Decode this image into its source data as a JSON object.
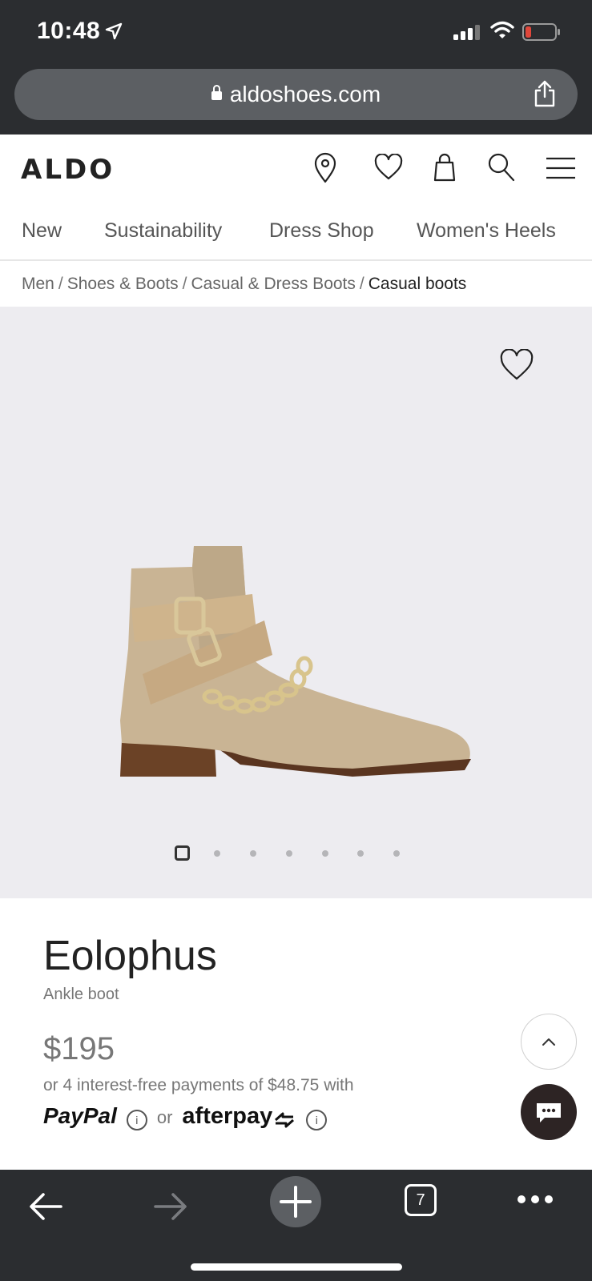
{
  "status": {
    "time": "10:48"
  },
  "browser": {
    "url": "aldoshoes.com",
    "tabs_count": "7"
  },
  "header": {
    "logo": "ALDO"
  },
  "nav": {
    "items": [
      "New",
      "Sustainability",
      "Dress Shop",
      "Women's Heels"
    ]
  },
  "breadcrumb": {
    "items": [
      "Men",
      "Shoes & Boots",
      "Casual & Dress Boots"
    ],
    "current": "Casual boots",
    "separator": "/"
  },
  "product": {
    "name": "Eolophus",
    "type": "Ankle boot",
    "price": "$195",
    "installments_text": "or 4 interest-free payments of $48.75 with",
    "paypal_label": "PayPal",
    "or_label": "or",
    "afterpay_label": "afterpay",
    "info_glyph": "i",
    "image_count": 7,
    "active_image": 1
  },
  "colors": {
    "chrome_dark": "#2b2d30",
    "url_bar": "#5c5f63",
    "hero_bg": "#edecf0",
    "chat_button": "#2d2424",
    "battery_low": "#e0473b"
  }
}
